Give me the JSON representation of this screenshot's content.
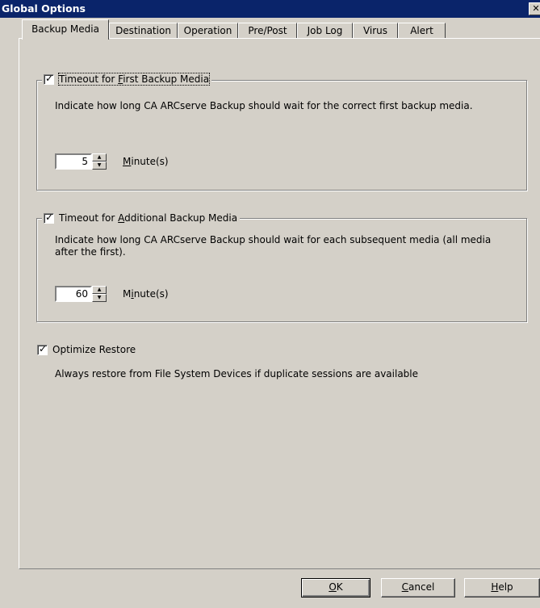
{
  "window": {
    "title": "Global Options",
    "close_label": "✕"
  },
  "tabs": [
    {
      "label": "Backup Media",
      "active": true
    },
    {
      "label": "Destination"
    },
    {
      "label": "Operation"
    },
    {
      "label": "Pre/Post"
    },
    {
      "label": "Job Log"
    },
    {
      "label": "Virus"
    },
    {
      "label": "Alert"
    }
  ],
  "first_media": {
    "checkbox_label_pre": "Timeout for ",
    "checkbox_label_key": "F",
    "checkbox_label_post": "irst Backup Media",
    "checked": true,
    "description": "Indicate how long CA ARCserve Backup should wait for the correct first backup media.",
    "value": "5",
    "unit_key": "M",
    "unit_rest": "inute(s)"
  },
  "additional_media": {
    "checkbox_label_pre": "Timeout for ",
    "checkbox_label_key": "A",
    "checkbox_label_post": "dditional Backup Media",
    "checked": true,
    "description": "Indicate how long CA ARCserve Backup should wait for each subsequent media (all media after the first).",
    "value": "60",
    "unit_pre": "M",
    "unit_key": "i",
    "unit_rest": "nute(s)"
  },
  "optimize": {
    "label": "Optimize Restore",
    "checked": true,
    "description": "Always restore from File System Devices if duplicate sessions are available"
  },
  "buttons": {
    "ok_key": "O",
    "ok_rest": "K",
    "cancel_key": "C",
    "cancel_rest": "ancel",
    "help_key": "H",
    "help_rest": "elp"
  },
  "icons": {
    "check": "check-icon",
    "spin_up": "spin-up-icon",
    "spin_down": "spin-down-icon"
  }
}
